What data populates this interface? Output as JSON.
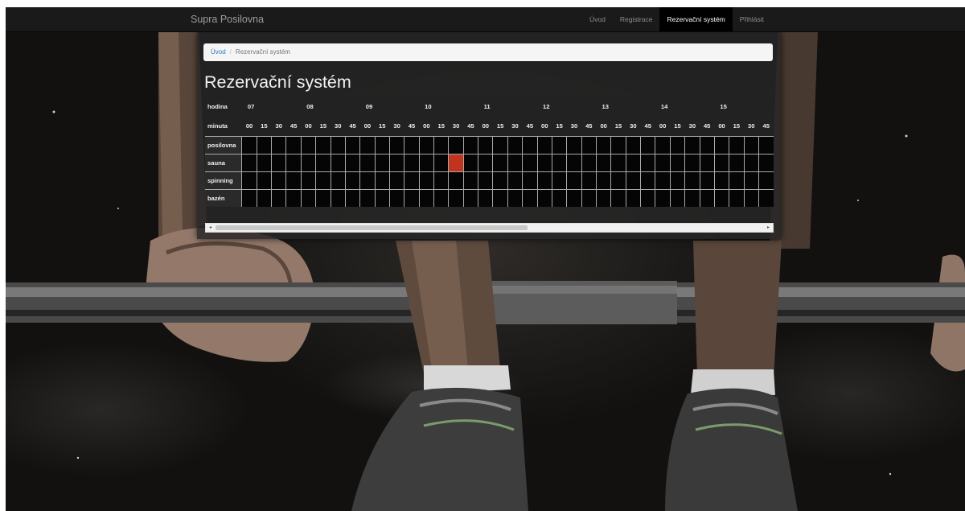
{
  "navbar": {
    "brand": "Supra Posilovna",
    "items": [
      {
        "label": "Úvod",
        "active": false
      },
      {
        "label": "Registrace",
        "active": false
      },
      {
        "label": "Rezervační systém",
        "active": true
      },
      {
        "label": "Přihlásit",
        "active": false
      }
    ]
  },
  "breadcrumb": {
    "home": "Úvod",
    "current": "Rezervační systém"
  },
  "page": {
    "title": "Rezervační systém"
  },
  "schedule": {
    "hour_label": "hodina",
    "minute_label": "minuta",
    "hours": [
      "07",
      "08",
      "09",
      "10",
      "11",
      "12",
      "13",
      "14",
      "15"
    ],
    "minutes": [
      "00",
      "15",
      "30",
      "45"
    ],
    "resources": [
      "posilovna",
      "sauna",
      "spinning",
      "bazén"
    ],
    "booked": [
      {
        "resource": "sauna",
        "hour": "10",
        "minute": "30"
      }
    ],
    "colors": {
      "booked": "#c1341e",
      "free": "#050505",
      "grid": "#a9a9a9"
    }
  },
  "scrollbar": {
    "left_arrow": "◂",
    "right_arrow": "▸",
    "position": 0.55
  }
}
